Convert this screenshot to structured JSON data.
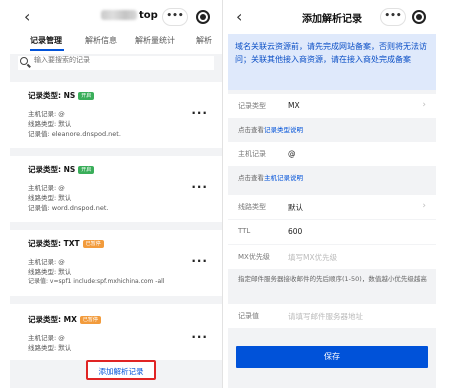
{
  "left": {
    "nav": {
      "back": "‹",
      "title_suffix": "top",
      "more": "•••"
    },
    "tabs": [
      "记录管理",
      "解析信息",
      "解析量统计",
      "解析"
    ],
    "search": {
      "placeholder": "输入要搜索的记录"
    },
    "records": [
      {
        "type": "记录类型: NS",
        "badge": "开启",
        "badge_color": "#3aae5a",
        "host": "主机记录: @",
        "line": "线路类型: 默认",
        "value": "记录值: eleanore.dnspod.net."
      },
      {
        "type": "记录类型: NS",
        "badge": "开启",
        "badge_color": "#3aae5a",
        "host": "主机记录: @",
        "line": "线路类型: 默认",
        "value": "记录值: word.dnspod.net."
      },
      {
        "type": "记录类型: TXT",
        "badge": "已暂停",
        "badge_color": "#f29b3c",
        "host": "主机记录: @",
        "line": "线路类型: 默认",
        "value": "记录值: v=spf1 include:spf.mxhichina.com -all"
      },
      {
        "type": "记录类型: MX",
        "badge": "已暂停",
        "badge_color": "#f29b3c",
        "host": "主机记录: @",
        "line": "线路类型: 默认",
        "value": ""
      }
    ],
    "add_button": "添加解析记录"
  },
  "right": {
    "nav": {
      "back": "‹",
      "title": "添加解析记录",
      "more": "•••"
    },
    "notice": "域名关联云资源前，请先完成网站备案，否则将无法访问；关联其他接入商资源，请在接入商处完成备案",
    "record_type": {
      "label": "记录类型",
      "value": "MX"
    },
    "hint_type": {
      "prefix": "点击查看",
      "link": "记录类型说明"
    },
    "host": {
      "label": "主机记录",
      "value": "@"
    },
    "hint_host": {
      "prefix": "点击查看",
      "link": "主机记录说明"
    },
    "line": {
      "label": "线路类型",
      "value": "默认"
    },
    "ttl": {
      "label": "TTL",
      "value": "600"
    },
    "mx_priority": {
      "label": "MX优先级",
      "placeholder": "填写MX优先级"
    },
    "priority_hint": "指定邮件服务器接收邮件的先后顺序(1-50)，数值越小优先级越高",
    "record_value": {
      "label": "记录值",
      "placeholder": "请填写邮件服务器地址"
    },
    "save": "保存"
  },
  "colors": {
    "accent": "#0052d9",
    "highlight_border": "#e02424",
    "notice_bg": "#dfe9fb"
  }
}
